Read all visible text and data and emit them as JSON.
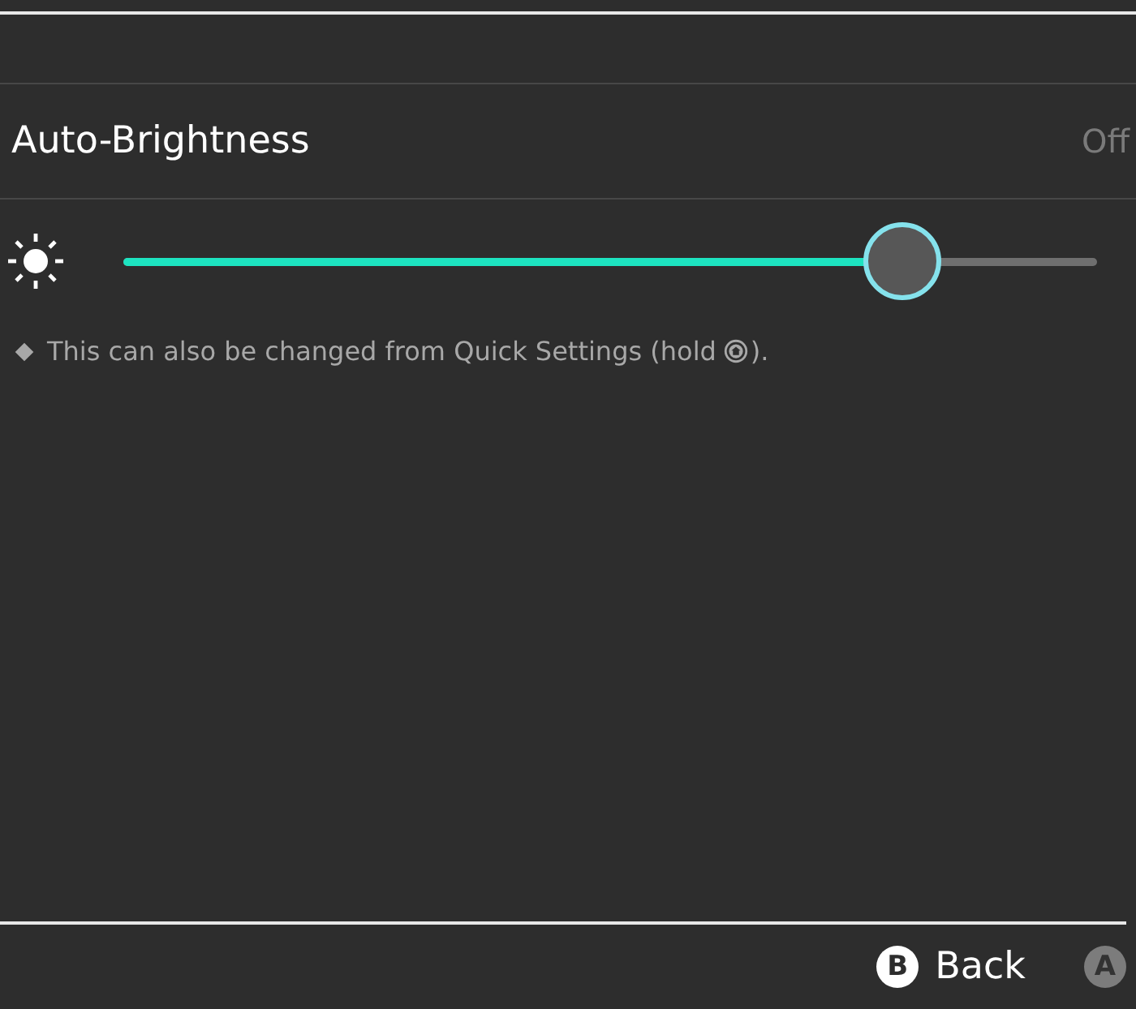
{
  "auto_brightness": {
    "label": "Auto-Brightness",
    "value": "Off"
  },
  "brightness_slider": {
    "level": 0.8
  },
  "note": {
    "text_before": "This can also be changed from Quick Settings (hold",
    "text_after": ")."
  },
  "footer_buttons": [
    {
      "key": "B",
      "label": "Back",
      "disabled": false
    },
    {
      "key": "A",
      "disabled": true
    }
  ]
}
